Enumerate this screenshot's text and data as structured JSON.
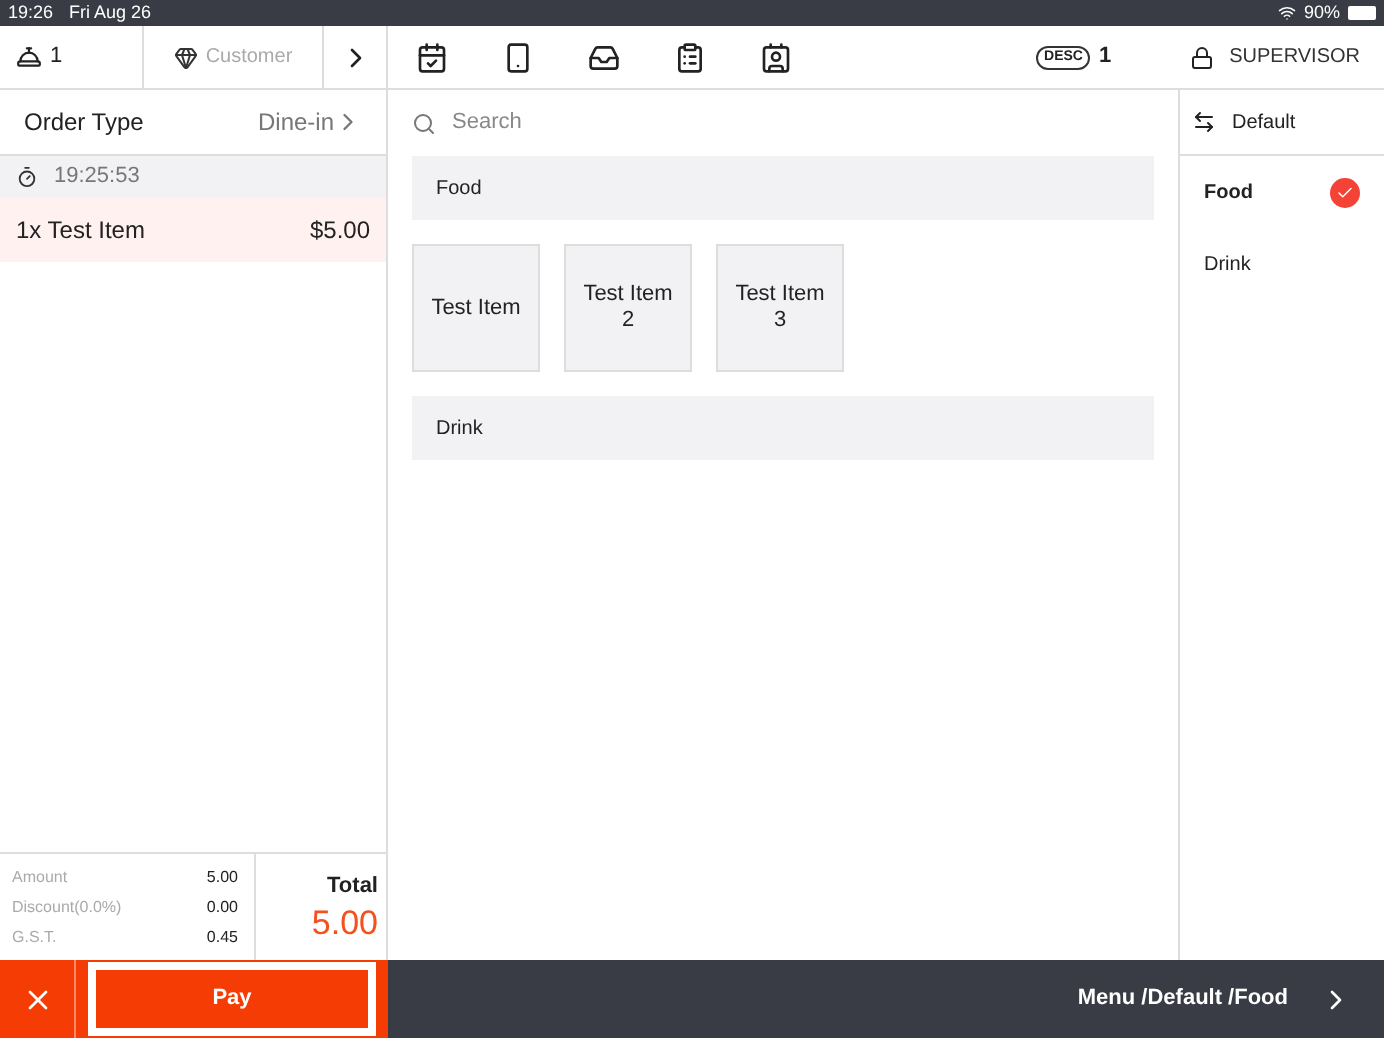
{
  "status_bar": {
    "time": "19:26",
    "date": "Fri Aug 26",
    "battery": "90%"
  },
  "top_bar": {
    "guests": "1",
    "customer": "Customer",
    "desc_label": "DESC",
    "desc_count": "1",
    "role": "SUPERVISOR"
  },
  "order": {
    "order_type_label": "Order Type",
    "order_type_value": "Dine-in",
    "timer": "19:25:53",
    "items": [
      {
        "name": "1x Test Item",
        "price": "$5.00",
        "selected": true
      }
    ],
    "summary": [
      {
        "label": "Amount",
        "value": "5.00"
      },
      {
        "label": "Discount(0.0%)",
        "value": "0.00"
      },
      {
        "label": "G.S.T.",
        "value": "0.45"
      }
    ],
    "total_label": "Total",
    "total_value": "5.00"
  },
  "search": {
    "placeholder": "Search"
  },
  "sections": [
    {
      "title": "Food",
      "items": [
        "Test Item",
        "Test Item 2",
        "Test Item 3"
      ]
    },
    {
      "title": "Drink"
    }
  ],
  "categories": {
    "header": "Default",
    "items": [
      {
        "label": "Food",
        "selected": true
      },
      {
        "label": "Drink",
        "selected": false
      }
    ]
  },
  "actions": {
    "pay": "Pay",
    "breadcrumb": "Menu /Default /Food"
  }
}
